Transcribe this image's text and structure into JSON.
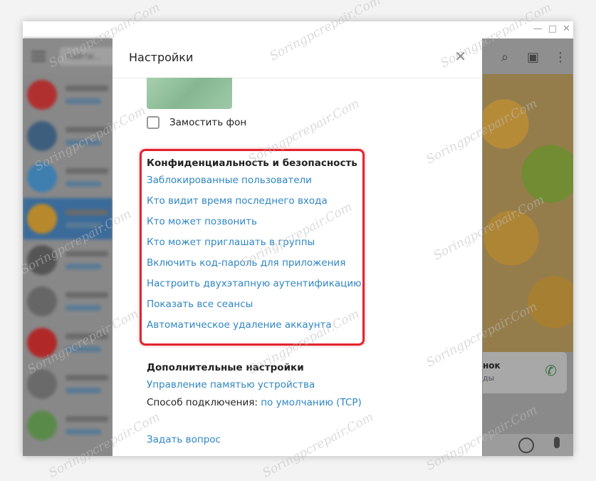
{
  "dialog": {
    "title": "Настройки",
    "tile_background_label": "Замостить фон",
    "privacy": {
      "title": "Конфиденциальность и безопасность",
      "links": [
        "Заблокированные пользователи",
        "Кто видит время последнего входа",
        "Кто может позвонить",
        "Кто может приглашать в группы",
        "Включить код-пароль для приложения",
        "Настроить двухэтапную аутентификацию",
        "Показать все сеансы",
        "Автоматическое удаление аккаунта"
      ]
    },
    "advanced": {
      "title": "Дополнительные настройки",
      "memory_link": "Управление памятью устройства",
      "connection_label": "Способ подключения:",
      "connection_value": "по умолчанию (TCP)"
    },
    "ask_question": "Задать вопрос"
  },
  "sidebar": {
    "search_placeholder": "Найти..."
  },
  "chat_preview": {
    "title": "нок",
    "subtitle": "ды"
  },
  "watermark_text": "Soringpcrepair.Com",
  "colors": {
    "link": "#2f86c2",
    "highlight": "#e0242e",
    "active_chat": "#3b6b9a"
  }
}
